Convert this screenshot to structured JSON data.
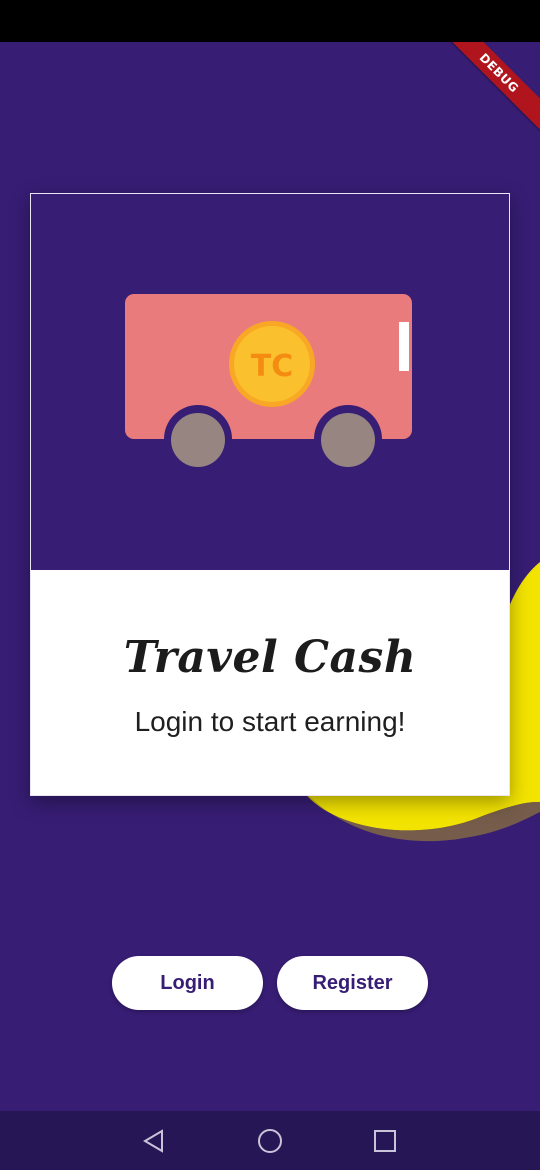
{
  "debug_banner": "DEBUG",
  "card": {
    "logo_text": "TC",
    "title": "Travel Cash",
    "subtitle": "Login to start earning!"
  },
  "buttons": {
    "login": "Login",
    "register": "Register"
  },
  "navigation": {
    "back_icon": "triangle-back-icon",
    "home_icon": "circle-home-icon",
    "recents_icon": "square-recents-icon"
  },
  "colors": {
    "background": "#371d74",
    "card_top": "#371d74",
    "van_body": "#e97b7c",
    "coin": "#fbc02d",
    "coin_text": "#f48c12",
    "wheel": "#978581",
    "accent_yellow": "#f5e400",
    "button_text": "#371d74"
  }
}
